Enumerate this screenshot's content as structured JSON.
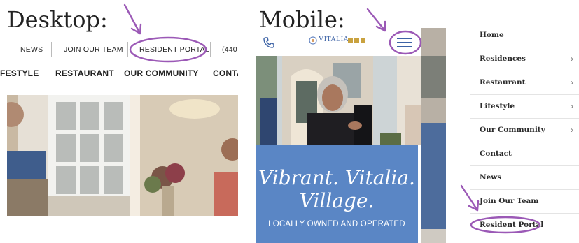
{
  "desktop": {
    "title": "Desktop:",
    "top_nav": {
      "news": "NEWS",
      "join": "JOIN OUR TEAM",
      "resident_portal": "RESIDENT PORTAL",
      "phone_partial": "(440"
    },
    "main_nav": {
      "lifestyle_partial": "FESTYLE",
      "restaurant": "RESTAURANT",
      "our_community": "OUR COMMUNITY",
      "contact_partial": "CONTA"
    }
  },
  "mobile": {
    "title": "Mobile:",
    "logo_text": "VITALIA",
    "hero_line1": "Vibrant. Vitalia.",
    "hero_line2": "Village.",
    "hero_sub": "LOCALLY OWNED AND OPERATED"
  },
  "menu": {
    "items": [
      {
        "label": "Home",
        "chevron": false
      },
      {
        "label": "Residences",
        "chevron": true
      },
      {
        "label": "Restaurant",
        "chevron": true
      },
      {
        "label": "Lifestyle",
        "chevron": true
      },
      {
        "label": "Our Community",
        "chevron": true
      },
      {
        "label": "Contact",
        "chevron": false
      },
      {
        "label": "News",
        "chevron": false
      },
      {
        "label": "Join Our Team",
        "chevron": false
      },
      {
        "label": "Resident Portal",
        "chevron": false
      }
    ],
    "chevron_glyph": "›"
  },
  "colors": {
    "annotation": "#9b59b6",
    "hero_blue": "#5a86c5",
    "menu_icon": "#3d63a6"
  },
  "icons": [
    "phone-icon",
    "hamburger-menu-icon",
    "chevron-right-icon",
    "arrow-annotation"
  ]
}
